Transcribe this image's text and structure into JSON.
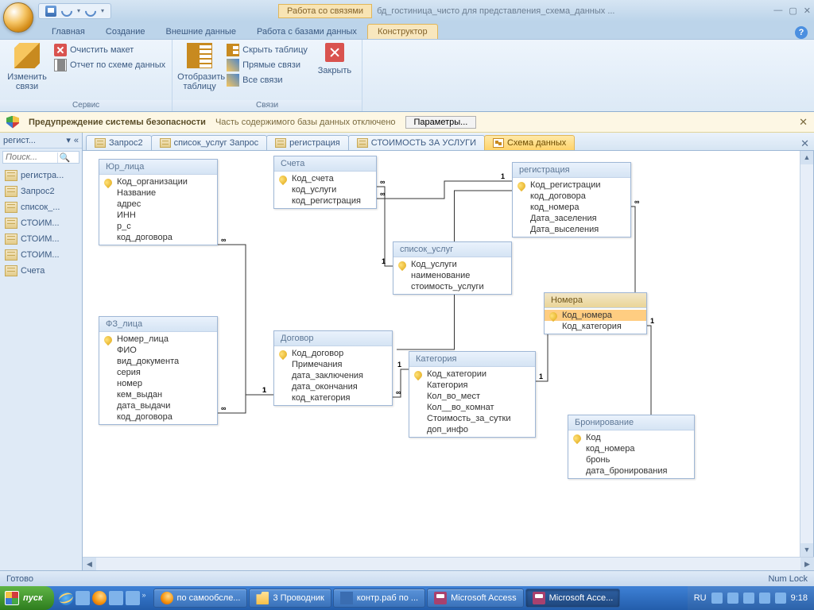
{
  "title": {
    "context": "Работа со связями",
    "doc": "бд_гостиница_чисто для представления_схема_данных ..."
  },
  "ribbon_tabs": [
    "Главная",
    "Создание",
    "Внешние данные",
    "Работа с базами данных",
    "Конструктор"
  ],
  "ribbon_active": 4,
  "ribbon": {
    "g1": {
      "label": "Сервис",
      "big": "Изменить связи",
      "s1": "Очистить макет",
      "s2": "Отчет по схеме данных"
    },
    "g2": {
      "label": "Связи",
      "big": "Отобразить таблицу",
      "s1": "Скрыть таблицу",
      "s2": "Прямые связи",
      "s3": "Все связи",
      "close": "Закрыть"
    }
  },
  "security": {
    "title": "Предупреждение системы безопасности",
    "msg": "Часть содержимого базы данных отключено",
    "btn": "Параметры..."
  },
  "nav": {
    "header": "регист...",
    "search": "Поиск...",
    "items": [
      "регистра...",
      "Запрос2",
      "список_...",
      "СТОИМ...",
      "СТОИМ...",
      "СТОИМ...",
      "Счета"
    ]
  },
  "doctabs": [
    "Запрос2",
    "список_услуг Запрос",
    "регистрация",
    "СТОИМОСТЬ ЗА УСЛУГИ",
    "Схема данных"
  ],
  "doctab_active": 4,
  "tables": {
    "yur": {
      "title": "Юр_лица",
      "fields": [
        "Код_организации",
        "Название",
        "адрес",
        "ИНН",
        "р_с",
        "код_договора"
      ],
      "pk": [
        0
      ]
    },
    "fiz": {
      "title": "ФЗ_лица",
      "fields": [
        "Номер_лица",
        "ФИО",
        "вид_документа",
        "серия",
        "номер",
        "кем_выдан",
        "дата_выдачи",
        "код_договора"
      ],
      "pk": [
        0
      ]
    },
    "sch": {
      "title": "Счета",
      "fields": [
        "Код_счета",
        "код_услуги",
        "код_регистрация"
      ],
      "pk": [
        0
      ]
    },
    "spis": {
      "title": "список_услуг",
      "fields": [
        "Код_услуги",
        "наименование",
        "стоимость_услуги"
      ],
      "pk": [
        0
      ]
    },
    "dog": {
      "title": "Договор",
      "fields": [
        "Код_договор",
        "Примечания",
        "дата_заключения",
        "дата_окончания",
        "код_категория"
      ],
      "pk": [
        0
      ]
    },
    "kat": {
      "title": "Категория",
      "fields": [
        "Код_категории",
        "Категория",
        "Кол_во_мест",
        "Кол__во_комнат",
        "Стоимость_за_сутки",
        "доп_инфо"
      ],
      "pk": [
        0
      ]
    },
    "reg": {
      "title": "регистрация",
      "fields": [
        "Код_регистрации",
        "код_договора",
        "код_номера",
        "Дата_заселения",
        "Дата_выселения"
      ],
      "pk": [
        0
      ]
    },
    "nom": {
      "title": "Номера",
      "fields": [
        "Код_номера",
        "Код_категория"
      ],
      "pk": [
        0
      ],
      "hl": [
        0
      ]
    },
    "bron": {
      "title": "Бронирование",
      "fields": [
        "Код",
        "код_номера",
        "бронь",
        "дата_бронирования"
      ],
      "pk": [
        0
      ]
    }
  },
  "status": {
    "left": "Готово",
    "right": "Num Lock"
  },
  "taskbar": {
    "start": "пуск",
    "tasks": [
      {
        "label": "по самообсле...",
        "active": false
      },
      {
        "label": "3 Проводник",
        "active": false
      },
      {
        "label": "контр.раб по ...",
        "active": false
      },
      {
        "label": "Microsoft Access",
        "active": false
      },
      {
        "label": "Microsoft Acce...",
        "active": true
      }
    ],
    "lang": "RU",
    "time": "9:18"
  }
}
